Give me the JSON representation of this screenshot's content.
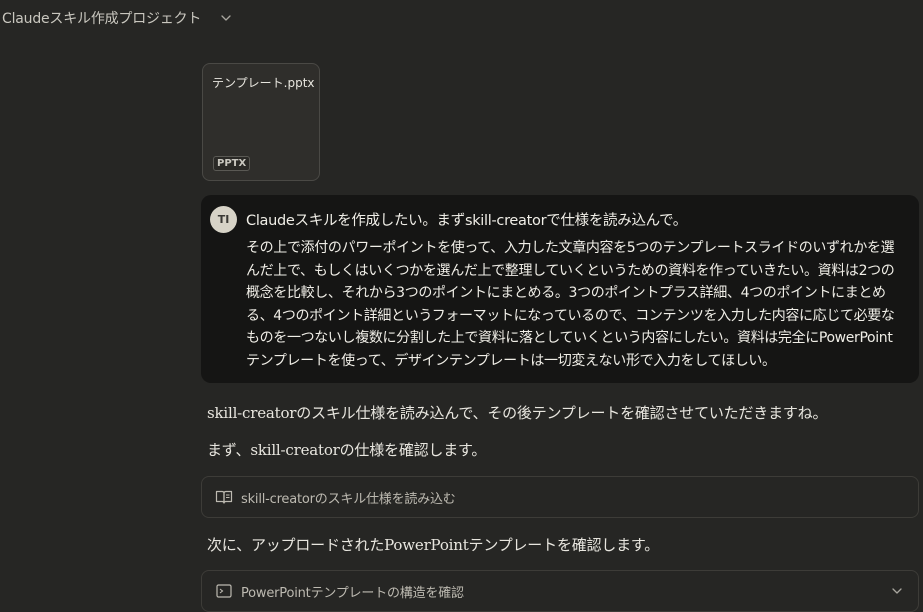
{
  "header": {
    "project_title": "Claudeスキル作成プロジェクト"
  },
  "attachment": {
    "file_name": "テンプレート.pptx",
    "file_type": "PPTX"
  },
  "user_message": {
    "avatar_initials": "TI",
    "first_line": "Claudeスキルを作成したい。まずskill-creatorで仕様を読み込んで。",
    "body": "その上で添付のパワーポイントを使って、入力した文章内容を5つのテンプレートスライドのいずれかを選んだ上で、もしくはいくつかを選んだ上で整理していくというための資料を作っていきたい。資料は2つの概念を比較し、それから3つのポイントにまとめる。3つのポイントプラス詳細、4つのポイントにまとめる、4つのポイント詳細というフォーマットになっているので、コンテンツを入力した内容に応じて必要なものを一つないし複数に分割した上で資料に落としていくという内容にしたい。資料は完全にPowerPointテンプレートを使って、デザインテンプレートは一切変えない形で入力をしてほしい。"
  },
  "assistant": {
    "line_1": "skill-creatorのスキル仕様を読み込んで、その後テンプレートを確認させていただきますね。",
    "line_2": "まず、skill-creatorの仕様を確認します。",
    "tool_1_label": "skill-creatorのスキル仕様を読み込む",
    "line_3": "次に、アップロードされたPowerPointテンプレートを確認します。",
    "tool_2_label": "PowerPointテンプレートの構造を確認"
  },
  "icons": {
    "header_chevron": "chevron-down-icon",
    "tool_1_icon": "book-open-icon",
    "tool_2_icon": "terminal-icon",
    "tool_2_chevron": "chevron-down-icon"
  },
  "colors": {
    "background": "#262624",
    "user_bubble": "#151514",
    "avatar": "#d7d3c7"
  }
}
